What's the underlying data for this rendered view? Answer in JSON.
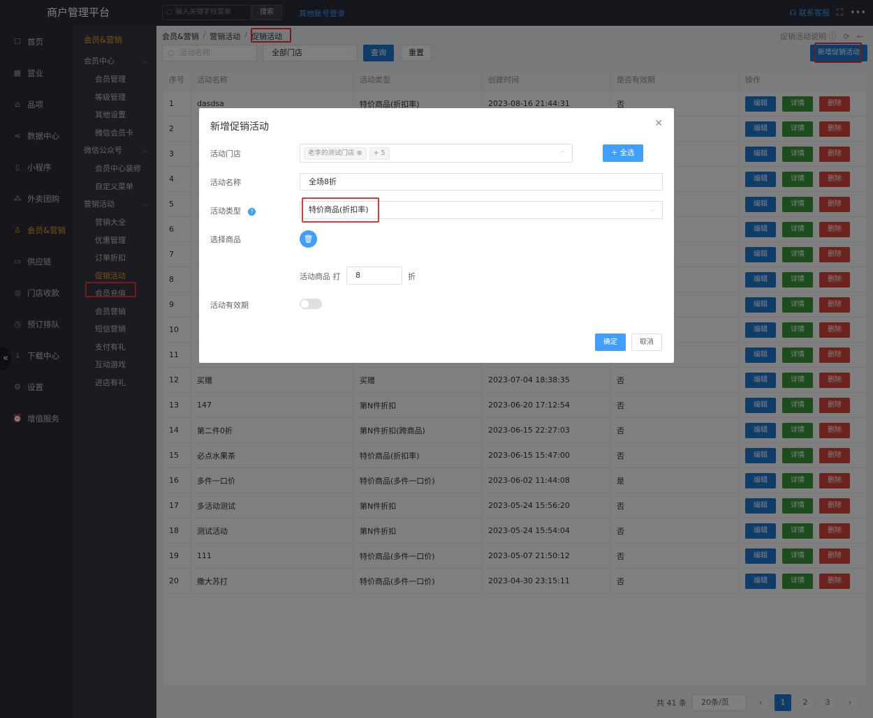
{
  "brand": "商户管理平台",
  "topbar": {
    "search_placeholder": "输入关键字找菜单",
    "search_button": "搜索",
    "other_login": "其他账号登录",
    "contact": "联系客服"
  },
  "nav": [
    {
      "label": "首页",
      "icon": "home-icon"
    },
    {
      "label": "营业",
      "icon": "calendar-icon"
    },
    {
      "label": "品项",
      "icon": "bag-icon"
    },
    {
      "label": "数据中心",
      "icon": "share-icon"
    },
    {
      "label": "小程序",
      "icon": "phone-icon"
    },
    {
      "label": "外卖团购",
      "icon": "group-icon"
    },
    {
      "label": "会员&营销",
      "icon": "user-icon",
      "active": true
    },
    {
      "label": "供应链",
      "icon": "truck-icon"
    },
    {
      "label": "门店收款",
      "icon": "coin-icon"
    },
    {
      "label": "预订排队",
      "icon": "clock-icon"
    },
    {
      "label": "下载中心",
      "icon": "download-icon"
    },
    {
      "label": "设置",
      "icon": "gear-icon"
    },
    {
      "label": "增值服务",
      "icon": "alarm-icon"
    }
  ],
  "subnav": {
    "heading": "会员&营销",
    "groups": [
      {
        "label": "会员中心",
        "items": [
          "会员管理",
          "等级管理",
          "其他设置",
          "微信会员卡"
        ]
      },
      {
        "label": "微信公众号",
        "items": [
          "会员中心装修",
          "自定义菜单"
        ]
      },
      {
        "label": "营销活动",
        "items": [
          "营销大全",
          "优惠管理",
          "订单折扣",
          "促销活动",
          "会员充值",
          "会员营销",
          "短信营销",
          "支付有礼",
          "互动游戏",
          "进店有礼"
        ]
      }
    ],
    "active_item": "促销活动"
  },
  "breadcrumb": [
    "会员&营销",
    "营销活动",
    "促销活动"
  ],
  "help_link": "促销活动说明",
  "filter": {
    "name_placeholder": "活动名称",
    "store_select": "全部门店",
    "query": "查询",
    "reset": "重置",
    "new_button": "新增促销活动"
  },
  "table": {
    "headers": [
      "序号",
      "活动名称",
      "活动类型",
      "创建时间",
      "是否有效期",
      "操作"
    ],
    "actions": {
      "edit": "编辑",
      "detail": "详情",
      "delete": "删除"
    },
    "rows": [
      [
        "1",
        "dasdsa",
        "特价商品(折扣率)",
        "2023-08-16 21:44:31",
        "否"
      ],
      [
        "2",
        "",
        "",
        "",
        ""
      ],
      [
        "3",
        "",
        "",
        "",
        ""
      ],
      [
        "4",
        "",
        "",
        "",
        ""
      ],
      [
        "5",
        "",
        "",
        "",
        ""
      ],
      [
        "6",
        "",
        "",
        "",
        ""
      ],
      [
        "7",
        "",
        "",
        "",
        ""
      ],
      [
        "8",
        "",
        "",
        "",
        ""
      ],
      [
        "9",
        "",
        "",
        "",
        ""
      ],
      [
        "10",
        "",
        "",
        "",
        ""
      ],
      [
        "11",
        "",
        "",
        "",
        ""
      ],
      [
        "12",
        "买赠",
        "买赠",
        "2023-07-04 18:38:35",
        "否"
      ],
      [
        "13",
        "147",
        "第N件折扣",
        "2023-06-20 17:12:54",
        "否"
      ],
      [
        "14",
        "第二件0折",
        "第N件折扣(跨商品)",
        "2023-06-15 22:27:03",
        "否"
      ],
      [
        "15",
        "必点水果茶",
        "特价商品(折扣率)",
        "2023-06-15 15:47:00",
        "否"
      ],
      [
        "16",
        "多件一口价",
        "特价商品(多件一口价)",
        "2023-06-02 11:44:08",
        "是"
      ],
      [
        "17",
        "多活动测试",
        "第N件折扣",
        "2023-05-24 15:56:20",
        "否"
      ],
      [
        "18",
        "测试活动",
        "第N件折扣",
        "2023-05-24 15:54:04",
        "否"
      ],
      [
        "19",
        "111",
        "特价商品(多件一口价)",
        "2023-05-07 21:50:12",
        "否"
      ],
      [
        "20",
        "撒大苏打",
        "特价商品(多件一口价)",
        "2023-04-30 23:15:11",
        "否"
      ]
    ]
  },
  "pagination": {
    "total": "共 41 条",
    "page_size": "20条/页",
    "pages": [
      "1",
      "2",
      "3"
    ],
    "current": "1"
  },
  "dialog": {
    "title": "新增促销活动",
    "store_label": "活动门店",
    "store_tag": "老李的测试门店",
    "store_more": "+ 5",
    "select_all": "+ 全选",
    "name_label": "活动名称",
    "name_value": "全场8折",
    "type_label": "活动类型",
    "type_value": "特价商品(折扣率)",
    "goods_label": "选择商品",
    "discount_prefix": "活动商品 打",
    "discount_value": "8",
    "discount_suffix": "折",
    "validity_label": "活动有效期",
    "ok": "确定",
    "cancel": "取消"
  }
}
